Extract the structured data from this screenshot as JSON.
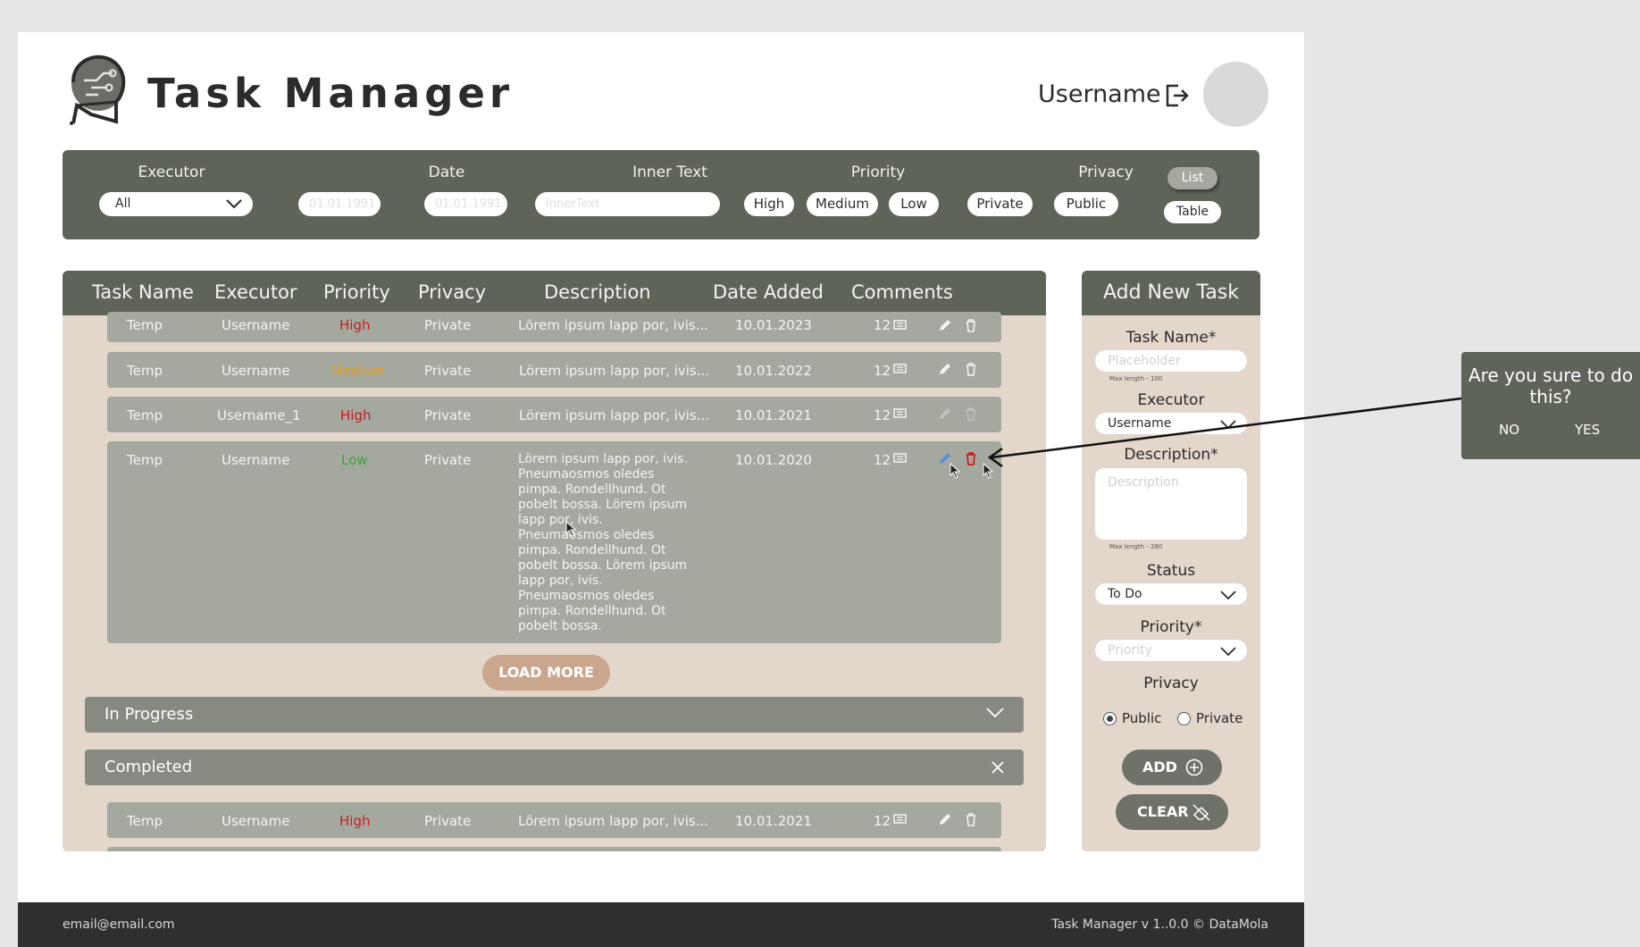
{
  "app": {
    "title": "Task Manager",
    "username": "Username"
  },
  "filters": {
    "executor_label": "Executor",
    "executor_value": "All",
    "date_label": "Date",
    "date_from_placeholder": "01.01.1991",
    "date_to_placeholder": "01.01.1991",
    "inner_text_label": "Inner Text",
    "inner_text_placeholder": "InnerText",
    "priority_label": "Priority",
    "priority_options": [
      "High",
      "Medium",
      "Low"
    ],
    "privacy_label": "Privacy",
    "privacy_options": [
      "Private",
      "Public"
    ],
    "view_list": "List",
    "view_table": "Table"
  },
  "table": {
    "headers": [
      "Task Name",
      "Executor",
      "Priority",
      "Privacy",
      "Description",
      "Date Added",
      "Comments"
    ],
    "rows": [
      {
        "name": "Temp",
        "executor": "Username",
        "priority": "High",
        "privacy": "Private",
        "description": "Lörem ipsum lapp por, ivis...",
        "date": "10.01.2023",
        "comments": "12"
      },
      {
        "name": "Temp",
        "executor": "Username",
        "priority": "Medium",
        "privacy": "Private",
        "description": "Lörem ipsum lapp por, ivis...",
        "date": "10.01.2022",
        "comments": "12"
      },
      {
        "name": "Temp",
        "executor": "Username_1",
        "priority": "High",
        "privacy": "Private",
        "description": "Lörem ipsum lapp por, ivis...",
        "date": "10.01.2021",
        "comments": "12"
      },
      {
        "name": "Temp",
        "executor": "Username",
        "priority": "Low",
        "privacy": "Private",
        "description": "Lörem ipsum lapp por, ivis. Pneumaosmos oledes pimpa. Rondellhund. Ot pobelt bossa. Lörem ipsum lapp por, ivis. Pneumaosmos oledes pimpa. Rondellhund. Ot pobelt bossa. Lörem ipsum lapp por, ivis. Pneumaosmos oledes pimpa. Rondellhund. Ot pobelt bossa.",
        "date": "10.01.2020",
        "comments": "12"
      }
    ],
    "load_more": "LOAD MORE",
    "groups": [
      "In Progress",
      "Completed"
    ],
    "completed_rows": [
      {
        "name": "Temp",
        "executor": "Username",
        "priority": "High",
        "privacy": "Private",
        "description": "Lörem ipsum lapp por, ivis...",
        "date": "10.01.2021",
        "comments": "12"
      }
    ]
  },
  "add_task": {
    "title": "Add New Task",
    "task_name_label": "Task Name*",
    "task_name_placeholder": "Placeholder",
    "task_name_hint": "Max length - 100",
    "executor_label": "Executor",
    "executor_value": "Username",
    "description_label": "Description*",
    "description_placeholder": "Description",
    "description_hint": "Max length - 280",
    "status_label": "Status",
    "status_value": "To Do",
    "priority_label": "Priority*",
    "priority_placeholder": "Priority",
    "privacy_label": "Privacy",
    "privacy_public": "Public",
    "privacy_private": "Private",
    "add_button": "ADD",
    "clear_button": "CLEAR"
  },
  "confirm": {
    "question": "Are you sure to do this?",
    "no": "NO",
    "yes": "YES"
  },
  "footer": {
    "email": "email@email.com",
    "version": "Task Manager v 1..0.0  © DataMola"
  },
  "colors": {
    "high": "#c81e1e",
    "medium": "#e0a020",
    "low": "#3aa53a",
    "panel_dark": "#5f6459",
    "panel_light": "#e3d6cb"
  }
}
